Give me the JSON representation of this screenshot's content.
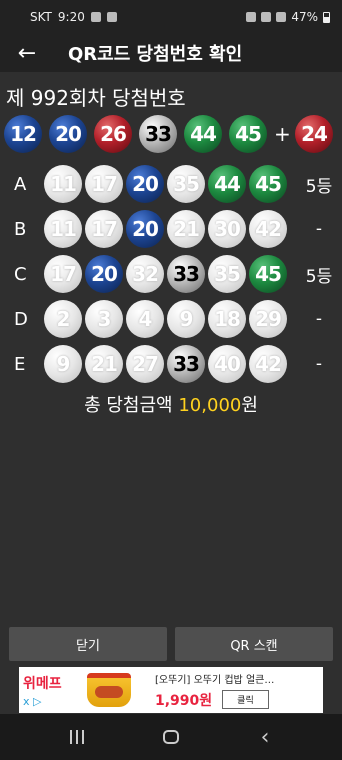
{
  "status_bar": {
    "carrier": "SKT",
    "time": "9:20",
    "battery": "47%"
  },
  "app_bar": {
    "title": "QR코드 당첨번호 확인",
    "back_icon": "arrow-left-icon"
  },
  "draw": {
    "title": "제 992회차 당첨번호"
  },
  "winning": {
    "numbers": [
      {
        "n": "12",
        "color": "#1d4593"
      },
      {
        "n": "20",
        "color": "#1d4593"
      },
      {
        "n": "26",
        "color": "#b3202a"
      },
      {
        "n": "33",
        "color": "#9a9a9a"
      },
      {
        "n": "44",
        "color": "#1d8a40"
      },
      {
        "n": "45",
        "color": "#1d8a40"
      }
    ],
    "plus": "+",
    "bonus": {
      "n": "24",
      "color": "#b3202a"
    }
  },
  "games": [
    {
      "label": "A",
      "result": "5등",
      "balls": [
        [
          "11",
          "white"
        ],
        [
          "17",
          "white"
        ],
        [
          "20",
          "blue"
        ],
        [
          "35",
          "white"
        ],
        [
          "44",
          "green"
        ],
        [
          "45",
          "green"
        ]
      ]
    },
    {
      "label": "B",
      "result": "-",
      "balls": [
        [
          "11",
          "white"
        ],
        [
          "17",
          "white"
        ],
        [
          "20",
          "blue"
        ],
        [
          "21",
          "white"
        ],
        [
          "30",
          "white"
        ],
        [
          "42",
          "white"
        ]
      ]
    },
    {
      "label": "C",
      "result": "5등",
      "balls": [
        [
          "17",
          "white"
        ],
        [
          "20",
          "blue"
        ],
        [
          "32",
          "white"
        ],
        [
          "33",
          "gray"
        ],
        [
          "35",
          "white"
        ],
        [
          "45",
          "green"
        ]
      ]
    },
    {
      "label": "D",
      "result": "-",
      "balls": [
        [
          "2",
          "white"
        ],
        [
          "3",
          "white"
        ],
        [
          "4",
          "white"
        ],
        [
          "9",
          "white"
        ],
        [
          "18",
          "white"
        ],
        [
          "29",
          "white"
        ]
      ]
    },
    {
      "label": "E",
      "result": "-",
      "balls": [
        [
          "9",
          "white"
        ],
        [
          "21",
          "white"
        ],
        [
          "27",
          "white"
        ],
        [
          "33",
          "gray"
        ],
        [
          "40",
          "white"
        ],
        [
          "42",
          "white"
        ]
      ]
    }
  ],
  "total": {
    "prefix": "총 당첨금액",
    "amount": "10,000",
    "suffix": "원",
    "amount_color": "#ffd21f"
  },
  "buttons": {
    "close": "닫기",
    "scan": "QR 스캔"
  },
  "ad": {
    "brand": "위메프",
    "adchoice": "x ▷",
    "title": "[오뚜기] 오뚜기 컵밥 얼큰…",
    "price": "1,990원",
    "cta": "클릭"
  },
  "navbar": {
    "recents_icon": "recents-icon",
    "home_icon": "home-icon",
    "back_icon": "back-chevron-icon"
  }
}
